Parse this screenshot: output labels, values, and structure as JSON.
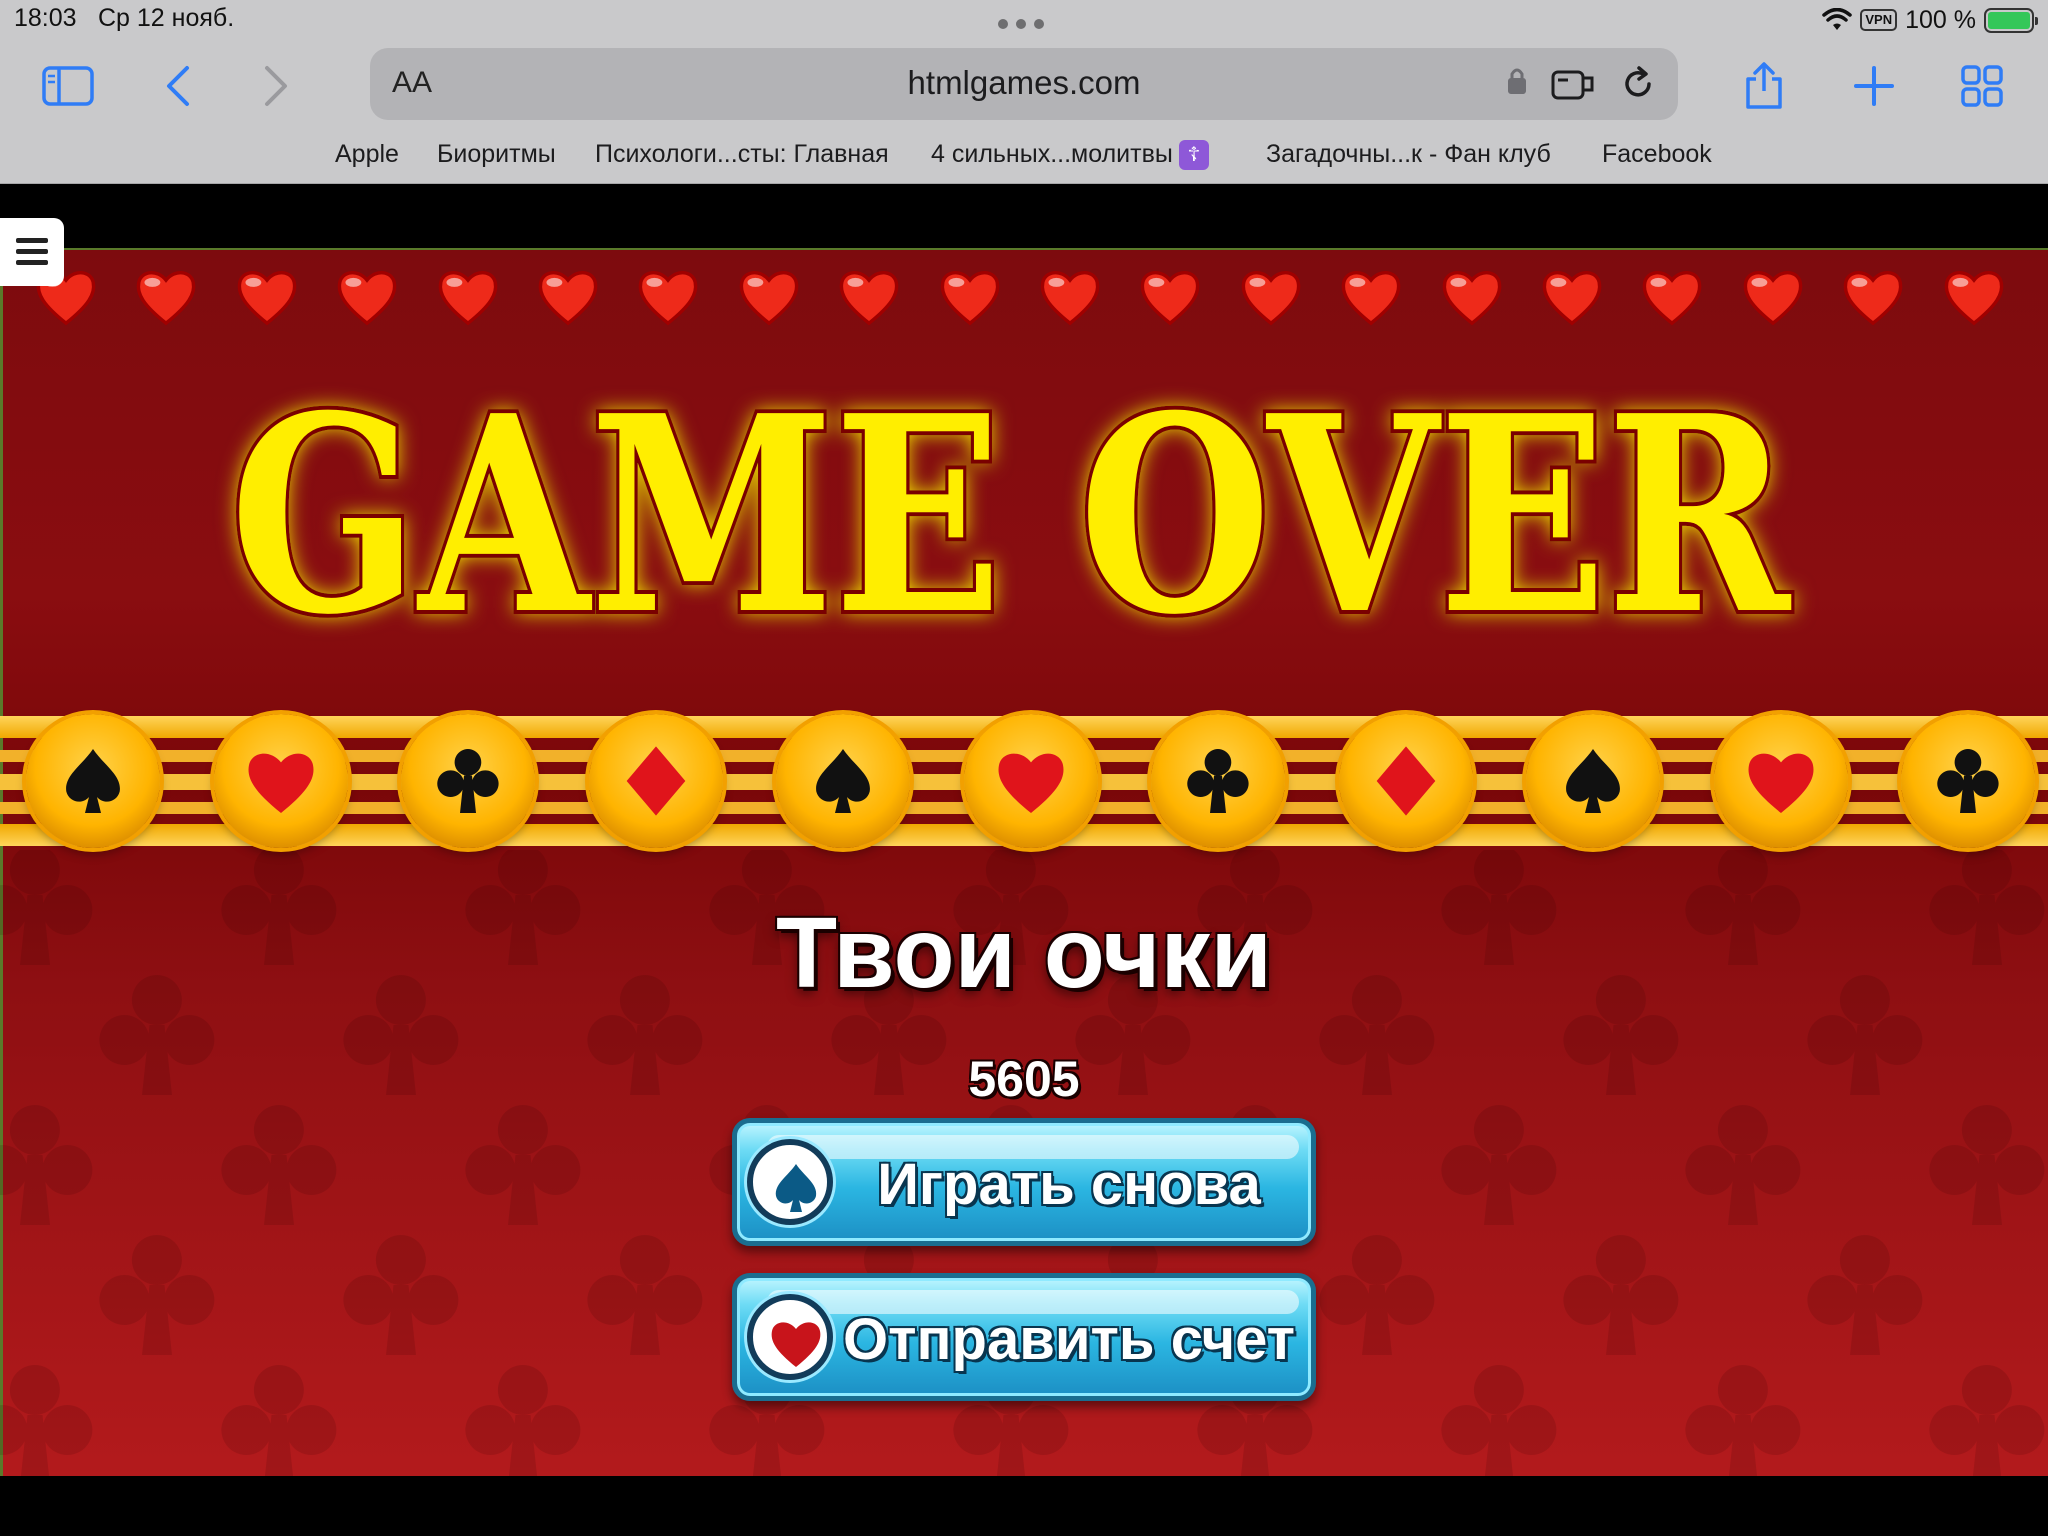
{
  "status_bar": {
    "time": "18:03",
    "date": "Ср 12 нояб.",
    "vpn": "VPN",
    "battery": "100 %"
  },
  "toolbar": {
    "text_size_label": "AA",
    "url": "htmlgames.com"
  },
  "bookmarks": [
    {
      "label": "Apple"
    },
    {
      "label": "Биоритмы"
    },
    {
      "label": "Психологи...сты: Главная"
    },
    {
      "label": "4 сильных...молитвы"
    },
    {
      "label": "Загадочны...к - Фан клуб"
    },
    {
      "label": "Facebook"
    }
  ],
  "game": {
    "title": "GAME OVER",
    "score_label": "Твои очки",
    "score": "5605",
    "play_again_label": "Играть снова",
    "submit_score_label": "Отправить счет",
    "colors": {
      "background": "#8a0d10",
      "title_fill": "#ffee00",
      "title_stroke": "#7a0000",
      "button": "#2bb6e2",
      "coin": "#ffb400"
    }
  }
}
